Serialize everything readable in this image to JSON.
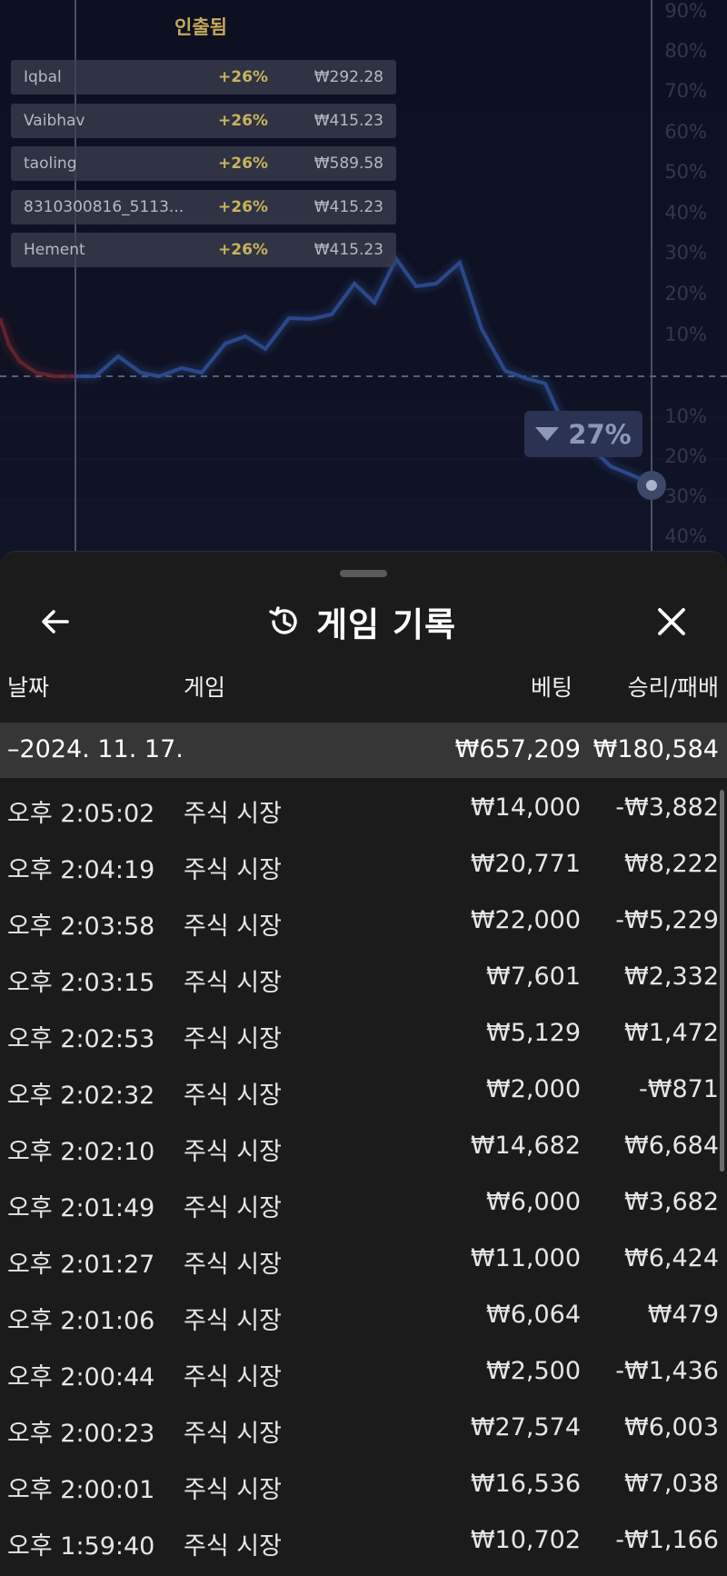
{
  "cashout": {
    "title": "인출됨",
    "rows": [
      {
        "name": "Iqbal",
        "pct": "+26%",
        "amount": "₩292.28"
      },
      {
        "name": "Vaibhav",
        "pct": "+26%",
        "amount": "₩415.23"
      },
      {
        "name": "taoling",
        "pct": "+26%",
        "amount": "₩589.58"
      },
      {
        "name": "8310300816_5113...",
        "pct": "+26%",
        "amount": "₩415.23"
      },
      {
        "name": "Hement",
        "pct": "+26%",
        "amount": "₩415.23"
      }
    ]
  },
  "chart": {
    "axis_labels_up": [
      "90%",
      "80%",
      "70%",
      "60%",
      "50%",
      "40%",
      "30%",
      "20%",
      "10%"
    ],
    "axis_labels_down": [
      "10%",
      "20%",
      "30%",
      "40%"
    ],
    "badge": "27%",
    "badge_direction": "down",
    "line_color": "#3a5ba8",
    "past_line_color": "#7a2a32"
  },
  "sheet": {
    "title": "게임 기록",
    "back_icon": "arrow-left-icon",
    "history_icon": "history-icon",
    "close_icon": "close-icon",
    "columns": {
      "date": "날짜",
      "game": "게임",
      "bet": "베팅",
      "win": "승리/패배"
    },
    "date_group": {
      "date": "–2024. 11. 17.",
      "bet": "₩657,209",
      "win": "₩180,584"
    },
    "rows": [
      {
        "time": "오후 2:05:02",
        "game": "주식 시장",
        "bet": "₩14,000",
        "win": "-₩3,882"
      },
      {
        "time": "오후 2:04:19",
        "game": "주식 시장",
        "bet": "₩20,771",
        "win": "₩8,222"
      },
      {
        "time": "오후 2:03:58",
        "game": "주식 시장",
        "bet": "₩22,000",
        "win": "-₩5,229"
      },
      {
        "time": "오후 2:03:15",
        "game": "주식 시장",
        "bet": "₩7,601",
        "win": "₩2,332"
      },
      {
        "time": "오후 2:02:53",
        "game": "주식 시장",
        "bet": "₩5,129",
        "win": "₩1,472"
      },
      {
        "time": "오후 2:02:32",
        "game": "주식 시장",
        "bet": "₩2,000",
        "win": "-₩871"
      },
      {
        "time": "오후 2:02:10",
        "game": "주식 시장",
        "bet": "₩14,682",
        "win": "₩6,684"
      },
      {
        "time": "오후 2:01:49",
        "game": "주식 시장",
        "bet": "₩6,000",
        "win": "₩3,682"
      },
      {
        "time": "오후 2:01:27",
        "game": "주식 시장",
        "bet": "₩11,000",
        "win": "₩6,424"
      },
      {
        "time": "오후 2:01:06",
        "game": "주식 시장",
        "bet": "₩6,064",
        "win": "₩479"
      },
      {
        "time": "오후 2:00:44",
        "game": "주식 시장",
        "bet": "₩2,500",
        "win": "-₩1,436"
      },
      {
        "time": "오후 2:00:23",
        "game": "주식 시장",
        "bet": "₩27,574",
        "win": "₩6,003"
      },
      {
        "time": "오후 2:00:01",
        "game": "주식 시장",
        "bet": "₩16,536",
        "win": "₩7,038"
      },
      {
        "time": "오후 1:59:40",
        "game": "주식 시장",
        "bet": "₩10,702",
        "win": "-₩1,166"
      }
    ]
  }
}
